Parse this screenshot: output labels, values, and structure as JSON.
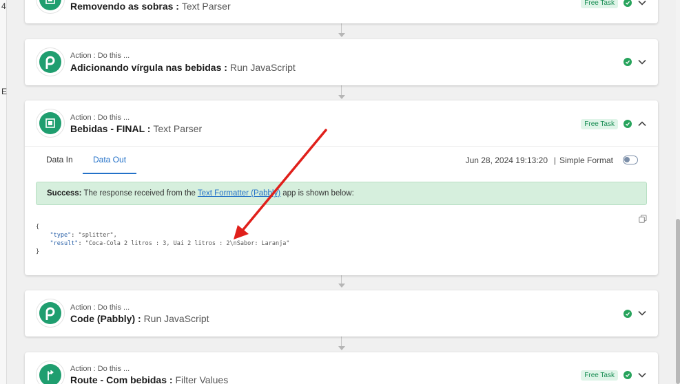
{
  "left_fragments": [
    "4",
    "E"
  ],
  "steps": [
    {
      "action_label": "",
      "title": "Removendo as sobras :",
      "app": "Text Parser",
      "badge": "Free Task",
      "icon": "text-parser-icon"
    },
    {
      "action_label": "Action : Do this ...",
      "title": "Adicionando vírgula nas bebidas :",
      "app": "Run JavaScript",
      "badge": "",
      "icon": "pabbly-p-icon"
    },
    {
      "action_label": "Action : Do this ...",
      "title": "Bebidas - FINAL :",
      "app": "Text Parser",
      "badge": "Free Task",
      "icon": "text-parser-icon",
      "expanded": true,
      "tabs": [
        "Data In",
        "Data Out"
      ],
      "active_tab": "Data Out",
      "timestamp": "Jun 28, 2024 19:13:20",
      "separator": "|",
      "simple_format_label": "Simple Format",
      "simple_format_on": false,
      "success": {
        "label": "Success:",
        "before": "The response received from the",
        "link": "Text Formatter (Pabbly)",
        "after": "app is shown below:"
      },
      "json_lines": {
        "open": "{",
        "type_key": "\"type\"",
        "type_val": "\"splitter\",",
        "result_key": "\"result\"",
        "result_val": "\"Coca-Cola 2 litros : 3, Uai 2 litros : 2\\nSabor: Laranja\"",
        "close": "}"
      }
    },
    {
      "action_label": "Action : Do this ...",
      "title": "Code (Pabbly) :",
      "app": "Run JavaScript",
      "badge": "",
      "icon": "pabbly-p-icon"
    },
    {
      "action_label": "Action : Do this ...",
      "title": "Route - Com bebidas :",
      "app": "Filter Values",
      "badge": "Free Task",
      "icon": "router-icon"
    }
  ],
  "colors": {
    "brand_green": "#1f9e6f",
    "check_green": "#27a35c",
    "link_blue": "#2371c8",
    "annotation_red": "#e0201b",
    "success_bg": "#d6efdd"
  }
}
